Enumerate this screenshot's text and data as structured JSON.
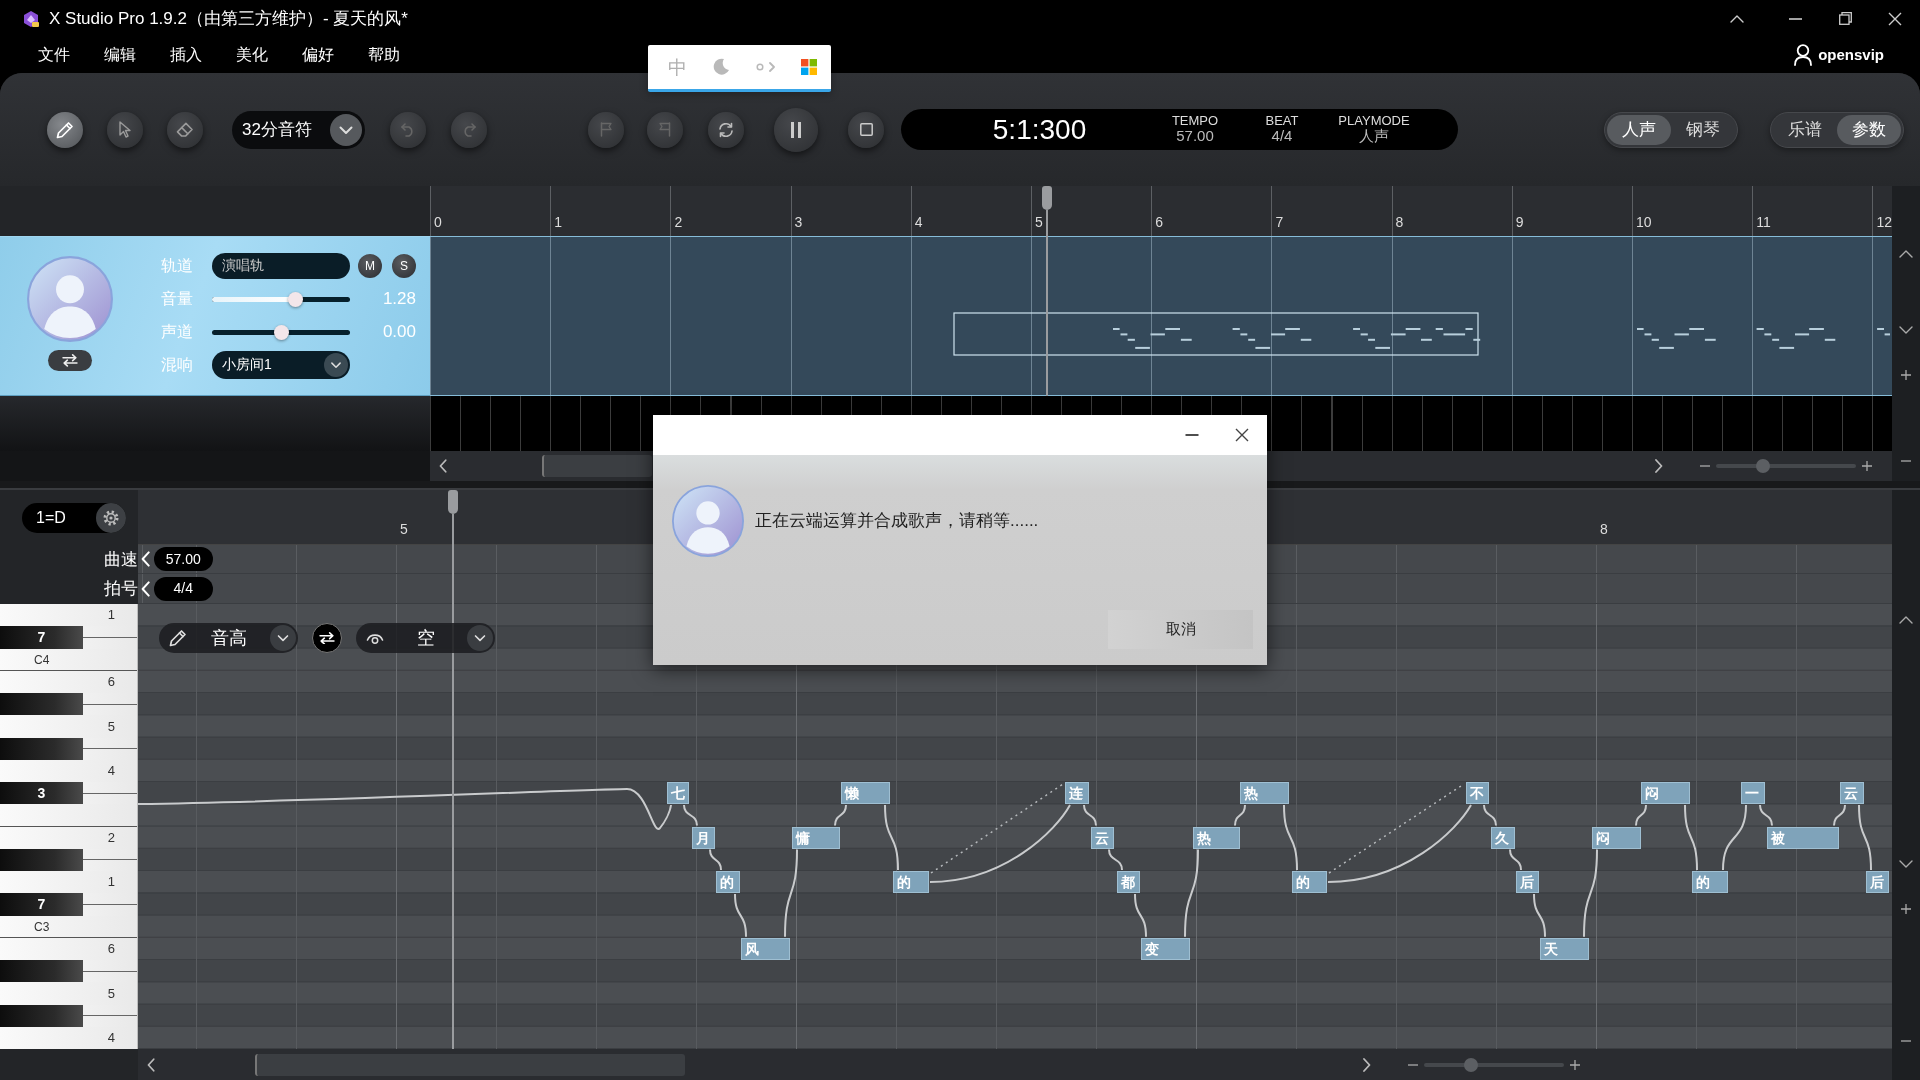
{
  "window": {
    "title": "X Studio Pro 1.9.2（由第三方维护）- 夏天的风*"
  },
  "menu": [
    {
      "label": "文件"
    },
    {
      "label": "编辑"
    },
    {
      "label": "插入"
    },
    {
      "label": "美化"
    },
    {
      "label": "偏好"
    },
    {
      "label": "帮助"
    }
  ],
  "account": {
    "name": "opensvip"
  },
  "ime_toolbar": {
    "mode": "中"
  },
  "toolbar": {
    "tools": [
      {
        "kind": "pencil",
        "selected": true
      },
      {
        "kind": "pointer",
        "selected": false
      },
      {
        "kind": "eraser",
        "selected": false
      }
    ],
    "note_length": "32分音符",
    "position": "5:1:300",
    "readouts": [
      {
        "label": "TEMPO",
        "value": "57.00"
      },
      {
        "label": "BEAT",
        "value": "4/4"
      },
      {
        "label": "PLAYMODE",
        "value": "人声"
      }
    ],
    "view_toggles": [
      {
        "options": [
          {
            "label": "人声",
            "selected": true
          },
          {
            "label": "钢琴",
            "selected": false
          }
        ]
      },
      {
        "options": [
          {
            "label": "乐谱",
            "selected": false
          },
          {
            "label": "参数",
            "selected": true
          }
        ]
      }
    ]
  },
  "arrangement": {
    "ruler": [
      "0",
      "1",
      "2",
      "3",
      "4",
      "5",
      "6",
      "7",
      "8",
      "9",
      "10",
      "11",
      "12"
    ],
    "track": {
      "name_label": "轨道",
      "name": "演唱轨",
      "mute": "M",
      "solo": "S",
      "volume": {
        "label": "音量",
        "level": 0.62,
        "reading": "1.28"
      },
      "pan": {
        "label": "声道",
        "level": 0.5,
        "reading": "0.00"
      },
      "reverb": {
        "label": "混响",
        "value": "小房间1"
      }
    },
    "zoom": {
      "level": 0.32
    }
  },
  "piano_roll": {
    "key": "1=D",
    "tempo": {
      "label": "曲速",
      "value": "57.00"
    },
    "beat": {
      "label": "拍号",
      "value": "4/4"
    },
    "ruler": [
      "5",
      "8"
    ],
    "keys": [
      {
        "kind": "white",
        "degree": "1"
      },
      {
        "kind": "black",
        "degree": "7"
      },
      {
        "kind": "white",
        "note": "C4"
      },
      {
        "kind": "white",
        "degree": "6"
      },
      {
        "kind": "black"
      },
      {
        "kind": "white",
        "degree": "5"
      },
      {
        "kind": "black"
      },
      {
        "kind": "white",
        "degree": "4"
      },
      {
        "kind": "black",
        "degree": "3"
      },
      {
        "kind": "white"
      },
      {
        "kind": "white",
        "degree": "2"
      },
      {
        "kind": "black"
      },
      {
        "kind": "white",
        "degree": "1"
      },
      {
        "kind": "black",
        "degree": "7"
      },
      {
        "kind": "white",
        "note": "C3"
      },
      {
        "kind": "white",
        "degree": "6"
      },
      {
        "kind": "black"
      },
      {
        "kind": "white",
        "degree": "5"
      },
      {
        "kind": "black"
      },
      {
        "kind": "white",
        "degree": "4"
      }
    ],
    "edit_bar": {
      "parameter": "音高",
      "view": "空"
    },
    "notes": [
      {
        "lyric": "七"
      },
      {
        "lyric": "月"
      },
      {
        "lyric": "的"
      },
      {
        "lyric": "风"
      },
      {
        "lyric": "慵"
      },
      {
        "lyric": "懒"
      },
      {
        "lyric": "的"
      },
      {
        "lyric": "连"
      },
      {
        "lyric": "云"
      },
      {
        "lyric": "都"
      },
      {
        "lyric": "变"
      },
      {
        "lyric": "热"
      },
      {
        "lyric": "热"
      },
      {
        "lyric": "的"
      },
      {
        "lyric": "不"
      },
      {
        "lyric": "久"
      },
      {
        "lyric": "后"
      },
      {
        "lyric": "天"
      },
      {
        "lyric": "闷"
      },
      {
        "lyric": "闷"
      },
      {
        "lyric": "的"
      },
      {
        "lyric": "一"
      },
      {
        "lyric": "被"
      },
      {
        "lyric": "云"
      },
      {
        "lyric": "后"
      }
    ],
    "zoom": {
      "level": 0.32
    }
  },
  "dialog": {
    "message": "正在云端运算并合成歌声，请稍等......",
    "button": "取消"
  }
}
